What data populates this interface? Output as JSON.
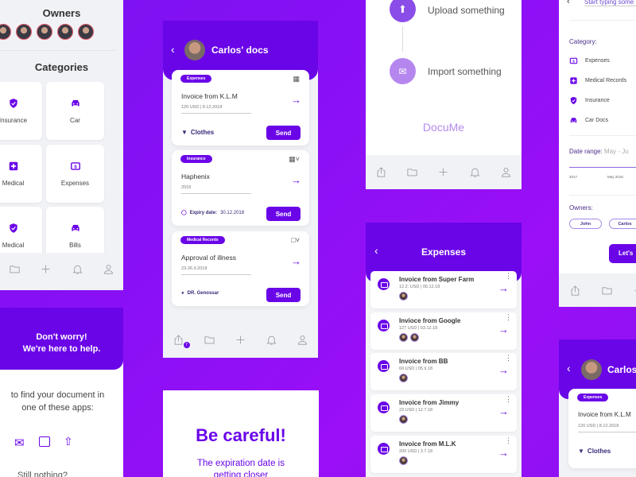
{
  "owners_screen": {
    "owners_heading": "Owners",
    "categories_heading": "Categories",
    "categories": [
      {
        "label": "Insurance",
        "icon": "shield-check-icon"
      },
      {
        "label": "Car",
        "icon": "car-icon"
      },
      {
        "label": "Medical",
        "icon": "medical-cross-icon"
      },
      {
        "label": "Expenses",
        "icon": "dollar-bill-icon"
      },
      {
        "label": "Medical",
        "icon": "shield-check-icon"
      },
      {
        "label": "Bills",
        "icon": "car-icon"
      }
    ]
  },
  "carlos_docs": {
    "title": "Carlos' docs",
    "documents": [
      {
        "tag": "Expenses",
        "title": "Invoice from K.L.M",
        "subtitle": "120 USD | 8.12.2018",
        "footer_icon": "shirt-icon",
        "footer": "Clothes",
        "send_label": "Send",
        "corner_icon": "image-icon"
      },
      {
        "tag": "Insurance",
        "title": "Haphenix",
        "subtitle": "2018",
        "footer_icon": "timer-icon",
        "footer_label": "Expiry date:",
        "footer": "30.12.2018",
        "send_label": "Send",
        "corner_icon": "image-icon"
      },
      {
        "tag": "Medical Records",
        "title": "Approval of illness",
        "subtitle": "23-26.9.2018",
        "footer_icon": "person-icon",
        "footer": "DR. Genossar",
        "send_label": "Send",
        "corner_icon": "file-icon"
      }
    ],
    "badge_count": "7"
  },
  "upload_screen": {
    "upload_label": "Upload something",
    "import_label": "Import something",
    "brand": "DocuMe"
  },
  "expenses": {
    "title": "Expenses",
    "items": [
      {
        "title": "Invoice from Super Farm",
        "subtitle": "12.2. USD | 05.12.18",
        "owners": 1
      },
      {
        "title": "Invioce from Google",
        "subtitle": "127 USD | 03.12.18",
        "owners": 2
      },
      {
        "title": "Invoice from BB",
        "subtitle": "60 USD | 05.9.18",
        "owners": 1
      },
      {
        "title": "Invoice from Jimmy",
        "subtitle": "23 USD | 12.7.18",
        "owners": 1
      },
      {
        "title": "Invoice from M.L.K",
        "subtitle": "200 USD | 3.7.18",
        "owners": 1
      }
    ]
  },
  "search_screen": {
    "search_placeholder": "Start typing some",
    "category_label": "Category:",
    "categories": [
      {
        "label": "Expenses",
        "icon": "dollar-bill-icon"
      },
      {
        "label": "Medical Records",
        "icon": "medical-cross-icon"
      },
      {
        "label": "Insurance",
        "icon": "shield-check-icon"
      },
      {
        "label": "Car Docs",
        "icon": "car-icon"
      }
    ],
    "date_range_label": "Date range:",
    "date_range_value": "May - Ju",
    "slider_ticks": [
      "2017",
      "May 2018"
    ],
    "owners_label": "Owners:",
    "owners": [
      "John",
      "Carlos"
    ],
    "submit_label": "Let's"
  },
  "help_screen": {
    "heading_line1": "Don't worry!",
    "heading_line2": "We're here to help.",
    "body_line1": "to find your document in",
    "body_line2": "one of these apps:",
    "trailing": "Still nothing?"
  },
  "careful_screen": {
    "heading": "Be careful!",
    "body_line1": "The expiration date is",
    "body_line2": "getting closer"
  },
  "carlos_docs_preview": {
    "title": "Carlos' docs",
    "tag": "Expenses",
    "doc_title": "Invoice from K.L.M",
    "doc_subtitle": "120 USD | 8.12.2018",
    "footer": "Clothes"
  },
  "colors": {
    "accent": "#6a05e8",
    "background": "#8a10f5",
    "surface": "#f1f2f6"
  }
}
